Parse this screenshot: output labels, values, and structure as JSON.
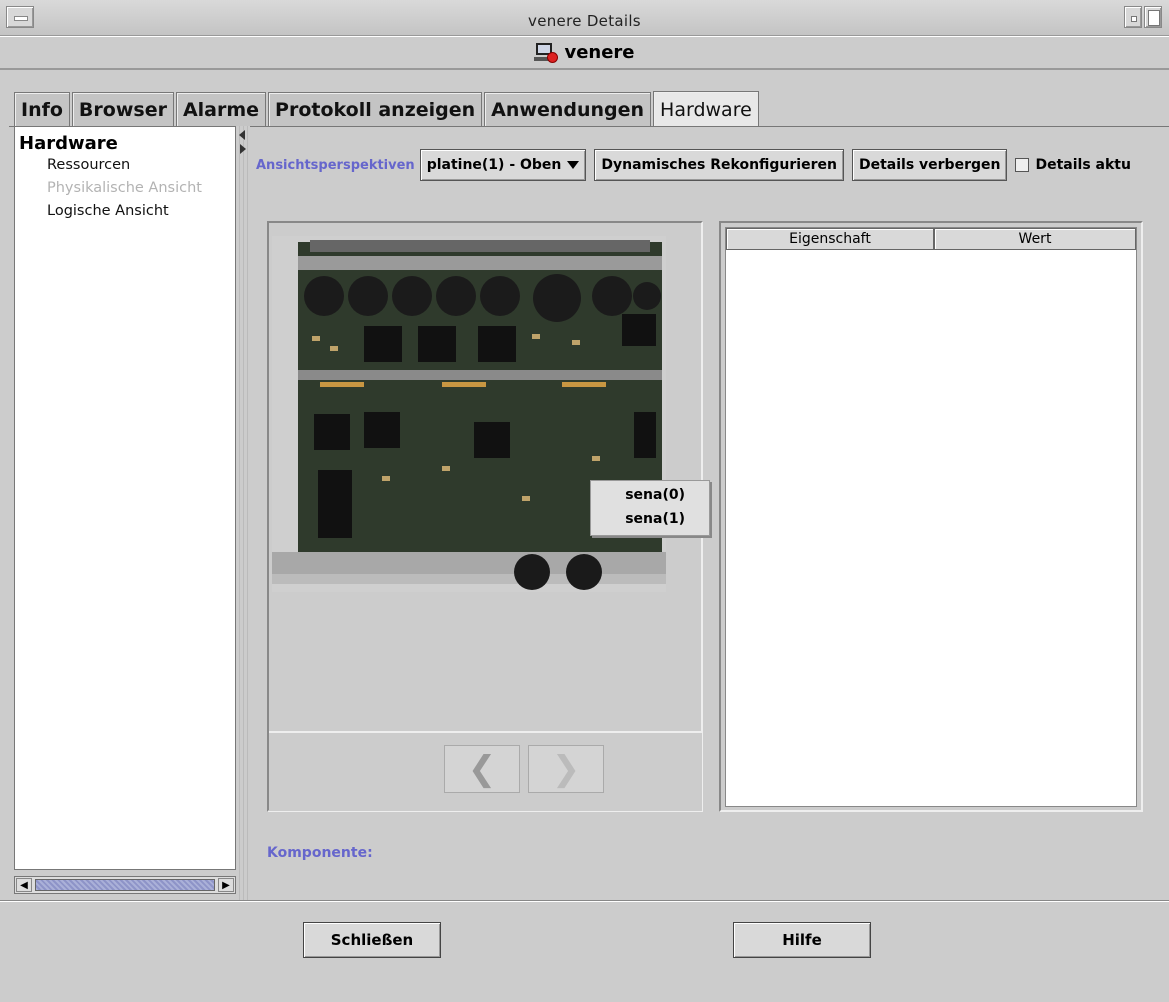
{
  "window": {
    "title": "venere Details",
    "host_name": "venere"
  },
  "tabs": [
    {
      "label": "Info",
      "active": false
    },
    {
      "label": "Browser",
      "active": false
    },
    {
      "label": "Alarme",
      "active": false
    },
    {
      "label": "Protokoll anzeigen",
      "active": false
    },
    {
      "label": "Anwendungen",
      "active": false
    },
    {
      "label": "Hardware",
      "active": true
    }
  ],
  "tree": {
    "root": "Hardware",
    "items": [
      {
        "label": "Ressourcen",
        "enabled": true
      },
      {
        "label": "Physikalische Ansicht",
        "enabled": false
      },
      {
        "label": "Logische Ansicht",
        "enabled": true
      }
    ]
  },
  "toolbar": {
    "perspective_label": "Ansichtsperspektiven",
    "perspective_value": "platine(1) - Oben",
    "reconfigure_label": "Dynamisches Rekonfigurieren",
    "hide_details_label": "Details verbergen",
    "update_details_label": "Details aktu"
  },
  "popup": {
    "items": [
      "sena(0)",
      "sena(1)"
    ]
  },
  "properties_table": {
    "columns": [
      "Eigenschaft",
      "Wert"
    ],
    "rows": []
  },
  "komponente_label": "Komponente:",
  "footer": {
    "close_label": "Schließen",
    "help_label": "Hilfe"
  },
  "colors": {
    "accent_label": "#6666cc",
    "background": "#cccccc"
  }
}
